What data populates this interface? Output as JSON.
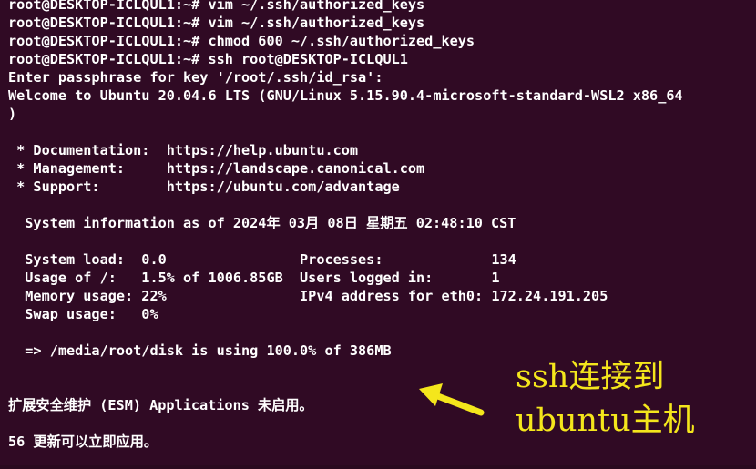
{
  "terminal": {
    "lines": [
      "root@DESKTOP-ICLQUL1:~# vim ~/.ssh/authorized_keys",
      "root@DESKTOP-ICLQUL1:~# vim ~/.ssh/authorized_keys",
      "root@DESKTOP-ICLQUL1:~# chmod 600 ~/.ssh/authorized_keys",
      "root@DESKTOP-ICLQUL1:~# ssh root@DESKTOP-ICLQUL1",
      "Enter passphrase for key '/root/.ssh/id_rsa':",
      "Welcome to Ubuntu 20.04.6 LTS (GNU/Linux 5.15.90.4-microsoft-standard-WSL2 x86_64",
      ")",
      "",
      " * Documentation:  https://help.ubuntu.com",
      " * Management:     https://landscape.canonical.com",
      " * Support:        https://ubuntu.com/advantage",
      "",
      "  System information as of 2024年 03月 08日 星期五 02:48:10 CST",
      "",
      "  System load:  0.0                Processes:             134",
      "  Usage of /:   1.5% of 1006.85GB  Users logged in:       1",
      "  Memory usage: 22%                IPv4 address for eth0: 172.24.191.205",
      "  Swap usage:   0%",
      "",
      "  => /media/root/disk is using 100.0% of 386MB",
      "",
      "",
      "扩展安全维护 (ESM) Applications 未启用。",
      "",
      "56 更新可以立即应用。"
    ]
  },
  "annotation": {
    "line1": "ssh连接到",
    "line2": "ubuntu主机",
    "color": "#f4e61c",
    "arrow_icon": "arrow-left-icon"
  },
  "colors": {
    "background": "#300a24",
    "text": "#ffffff"
  }
}
